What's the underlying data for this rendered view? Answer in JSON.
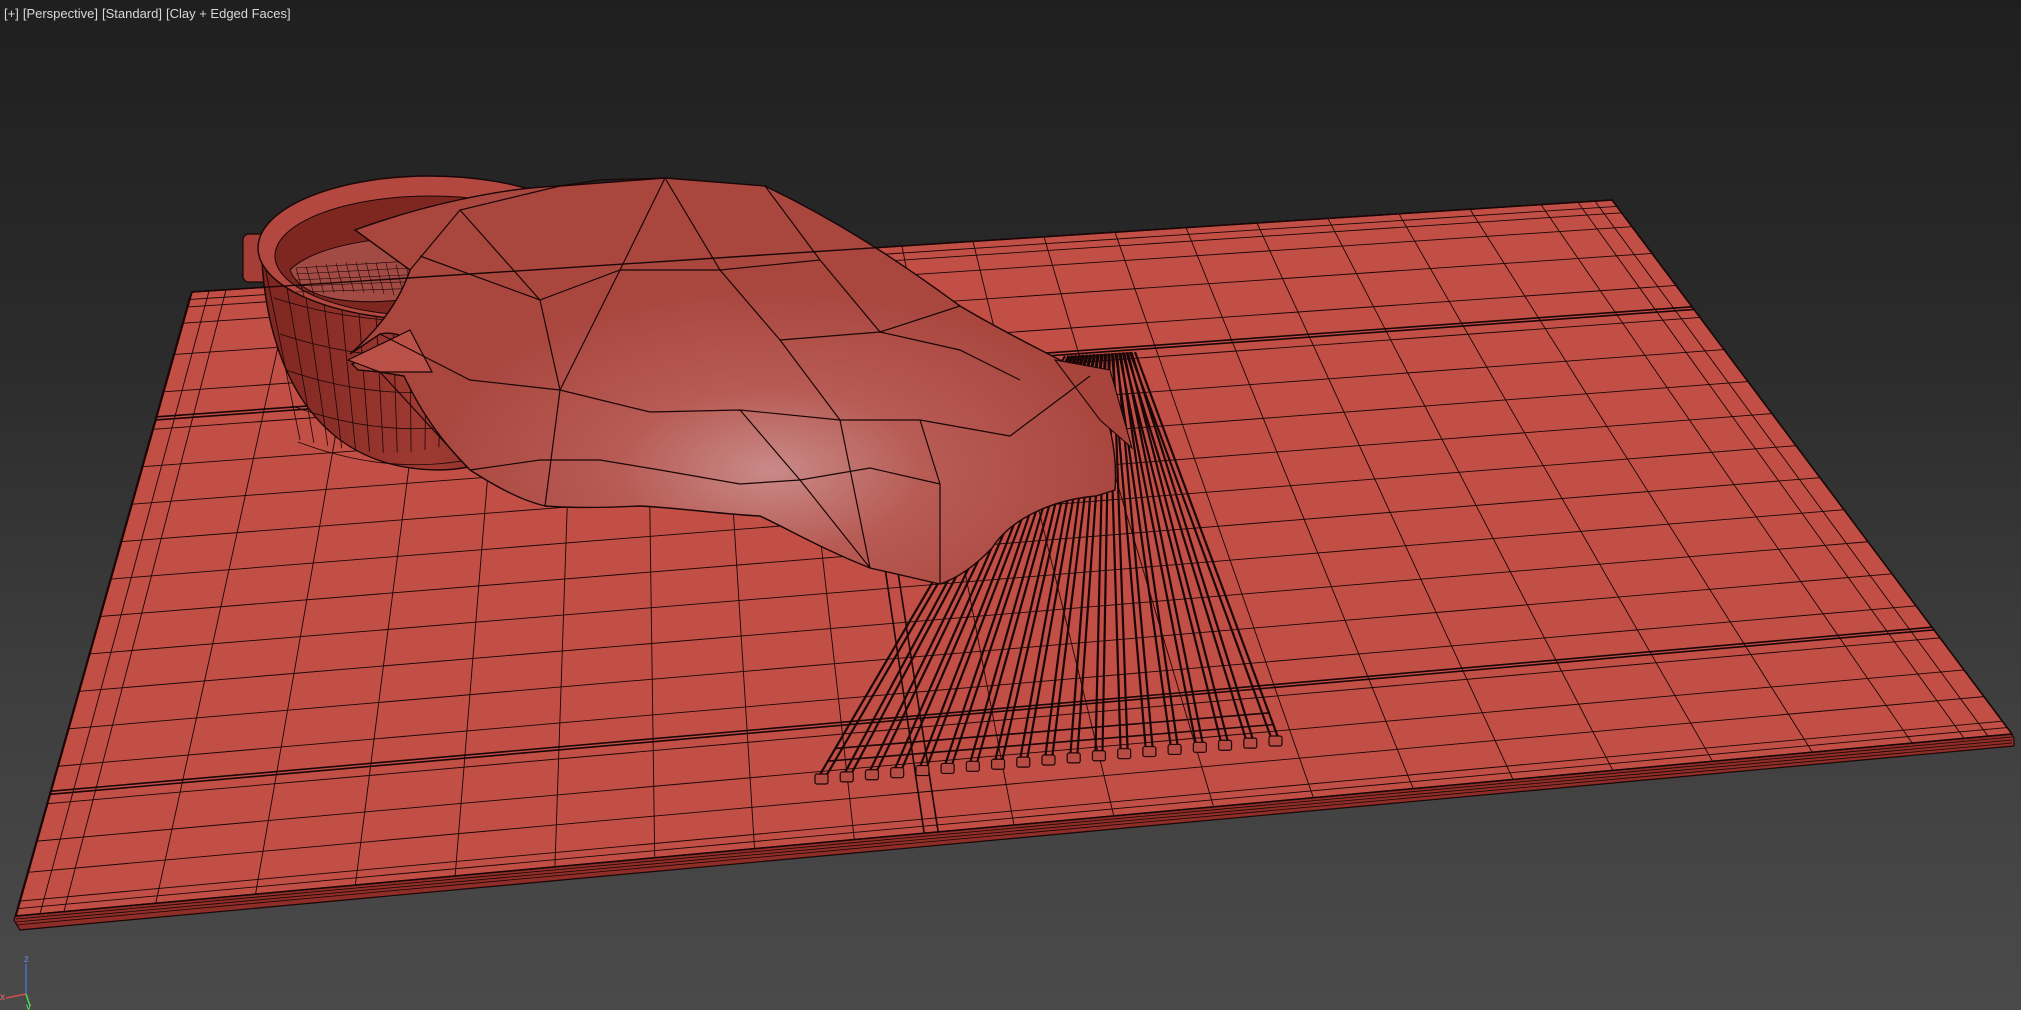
{
  "viewport": {
    "labels": [
      "[+]",
      "[Perspective]",
      "[Standard]",
      "[Clay + Edged Faces]"
    ],
    "axis": {
      "x": "x",
      "y": "y",
      "z": "z"
    },
    "shading_mode": "Clay + Edged Faces",
    "colors": {
      "clay": "#c14f45",
      "clay_dark": "#8f2e28",
      "wire": "#1a0606",
      "background_top": "#1f1f1f",
      "background_bottom": "#4a4a4a"
    }
  },
  "scene": {
    "objects": [
      {
        "name": "cutting-board",
        "icon": "plane-mesh"
      },
      {
        "name": "pot",
        "icon": "cylinder-mesh"
      },
      {
        "name": "fish",
        "icon": "organic-mesh"
      },
      {
        "name": "grill-rack",
        "icon": "rack-mesh"
      }
    ]
  }
}
